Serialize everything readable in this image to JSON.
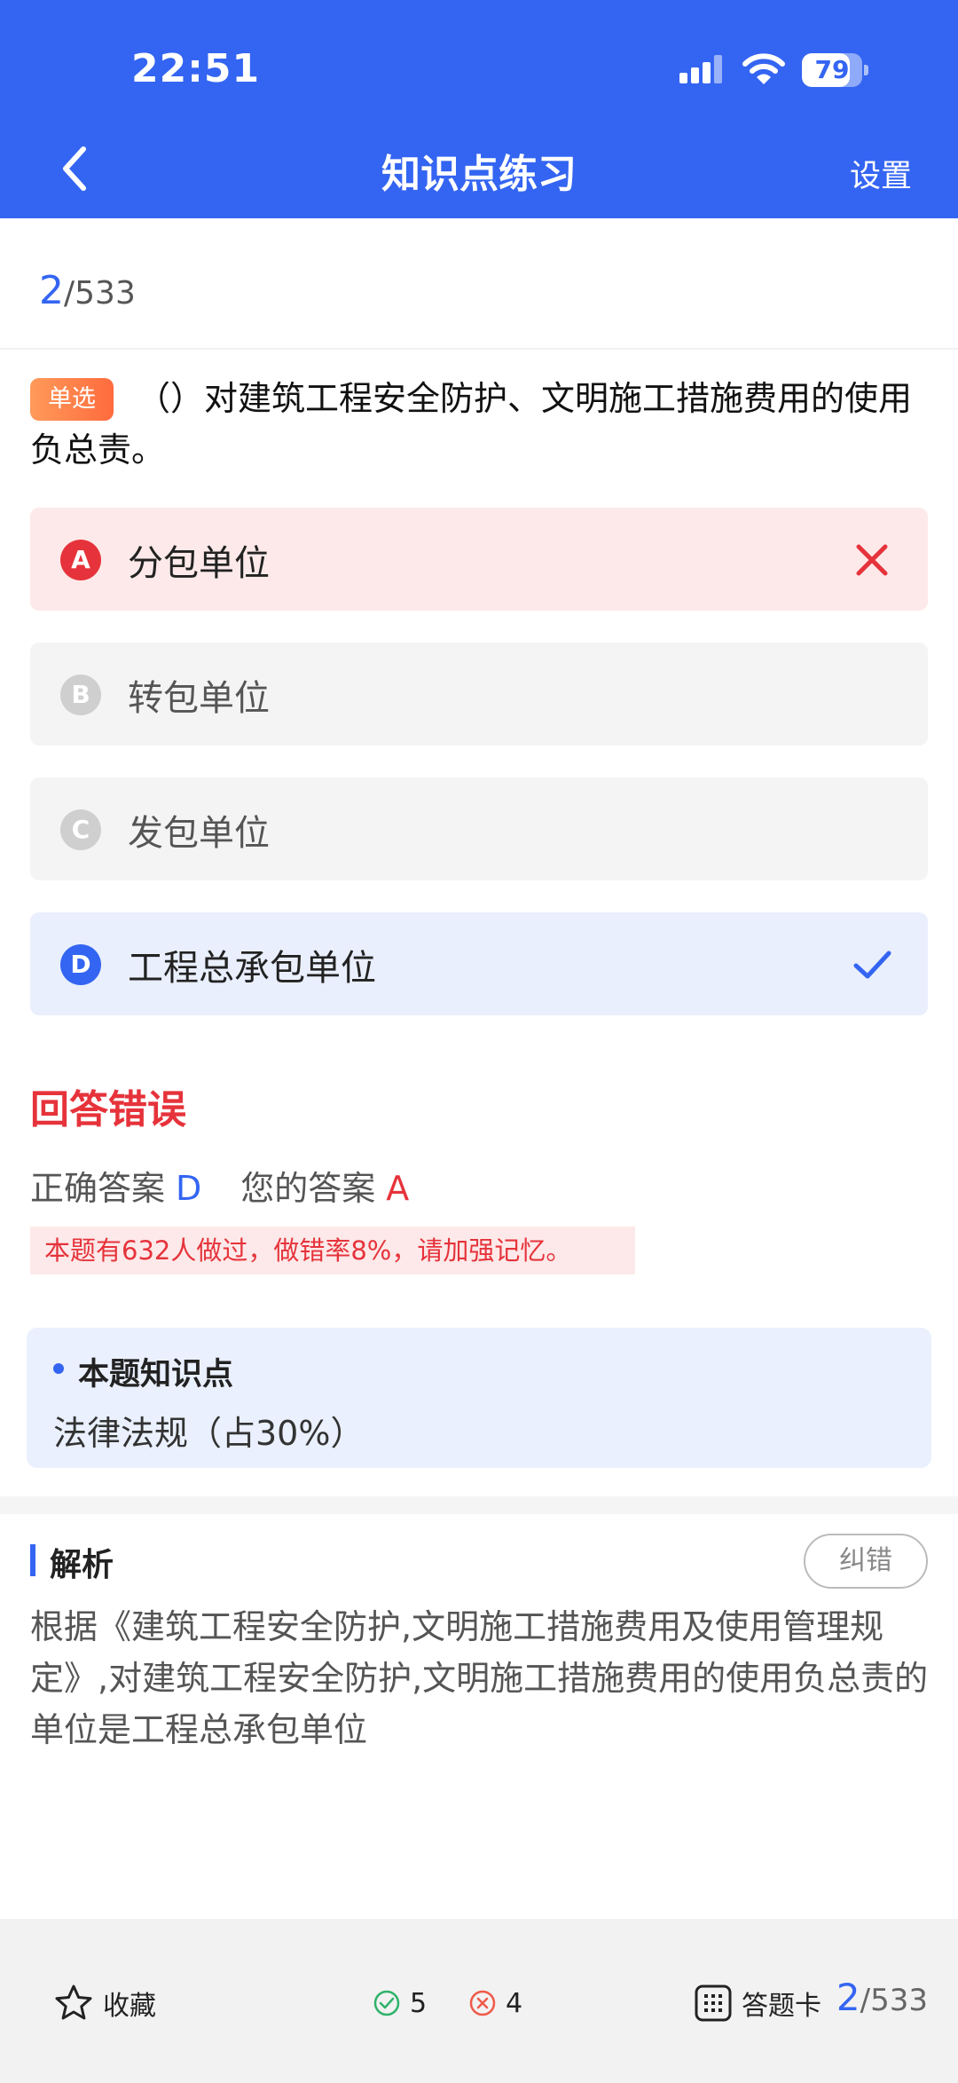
{
  "status_bar": {
    "time": "22:51",
    "battery": "79",
    "battery_level": 0.79
  },
  "nav": {
    "title": "知识点练习",
    "settings": "设置"
  },
  "progress": {
    "current": "2",
    "total": "/533"
  },
  "question": {
    "type_tag": "单选",
    "text": "（）对建筑工程安全防护、文明施工措施费用的使用负总责。",
    "options": [
      {
        "letter": "A",
        "text": "分包单位",
        "state": "wrong"
      },
      {
        "letter": "B",
        "text": "转包单位",
        "state": "normal"
      },
      {
        "letter": "C",
        "text": "发包单位",
        "state": "normal"
      },
      {
        "letter": "D",
        "text": "工程总承包单位",
        "state": "correct"
      }
    ]
  },
  "result": {
    "title": "回答错误",
    "correct_label": "正确答案",
    "correct_value": "D",
    "yours_label": "您的答案",
    "yours_value": "A",
    "stat_note": "本题有632人做过，做错率8%，请加强记忆。"
  },
  "knowledge": {
    "title": "本题知识点",
    "value": "法律法规（占30%）"
  },
  "analysis": {
    "title": "解析",
    "report_button": "纠错",
    "text": "根据《建筑工程安全防护,文明施工措施费用及使用管理规定》,对建筑工程安全防护,文明施工措施费用的使用负总责的单位是工程总承包单位"
  },
  "footer": {
    "favorite": "收藏",
    "correct_count": "5",
    "wrong_count": "4",
    "answer_card": "答题卡",
    "current": "2",
    "total": "/533"
  },
  "colors": {
    "primary": "#3465f2",
    "error": "#e6333b",
    "tag": "#ff6b3d",
    "success": "#2fb36b"
  }
}
